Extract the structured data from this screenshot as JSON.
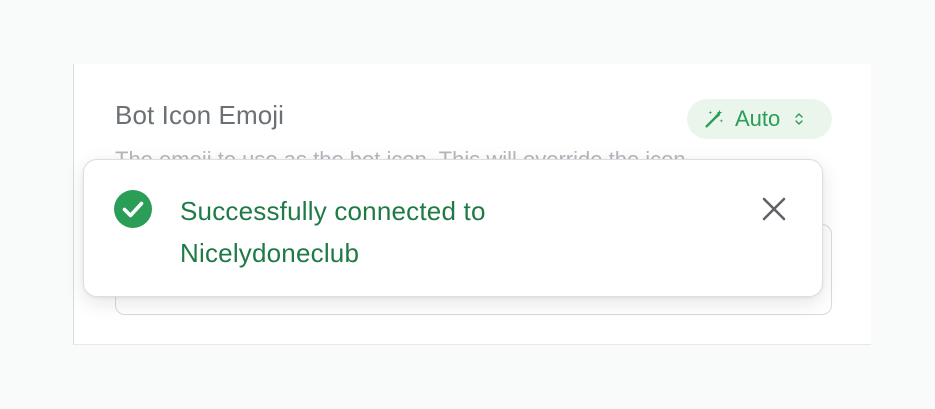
{
  "field": {
    "label": "Bot Icon Emoji",
    "description": "The emoji to use as the bot icon. This will override the icon",
    "mode_label": "Auto",
    "mode_icon": "magic-wand-icon",
    "mode_chevron_icon": "chevron-up-down-icon"
  },
  "toast": {
    "message": "Successfully connected to Nicelydoneclub",
    "status_icon": "check-circle-icon",
    "close_icon": "close-icon"
  },
  "colors": {
    "success_green": "#2a9d57",
    "success_text": "#1f7a46",
    "pill_bg": "#eaf6ec",
    "label_gray": "#6b7075"
  }
}
